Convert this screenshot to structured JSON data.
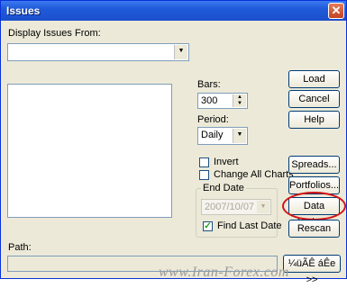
{
  "window": {
    "title": "Issues",
    "close_glyph": "✕"
  },
  "display": {
    "label": "Display Issues From:",
    "value": ""
  },
  "bars": {
    "label": "Bars:",
    "value": "300"
  },
  "period": {
    "label": "Period:",
    "value": "Daily"
  },
  "options": {
    "invert": {
      "label": "Invert",
      "checked": false
    },
    "change_all_charts": {
      "label": "Change All Charts",
      "checked": false
    }
  },
  "end_date": {
    "group_label": "End Date",
    "value": "2007/10/07",
    "find_last_date": {
      "label": "Find Last Date",
      "checked": true
    }
  },
  "buttons": {
    "load": "Load",
    "cancel": "Cancel",
    "help": "Help",
    "spreads": "Spreads...",
    "portfolios": "Portfolios...",
    "data_paths": "Data Paths...",
    "rescan": "Rescan",
    "more": "¼üÃÊ áÊe >>"
  },
  "path": {
    "label": "Path:",
    "value": ""
  },
  "watermark": "www.Iran-Forex.com",
  "colors": {
    "titlebar": "#1f5ad9",
    "highlight": "#d41414"
  }
}
